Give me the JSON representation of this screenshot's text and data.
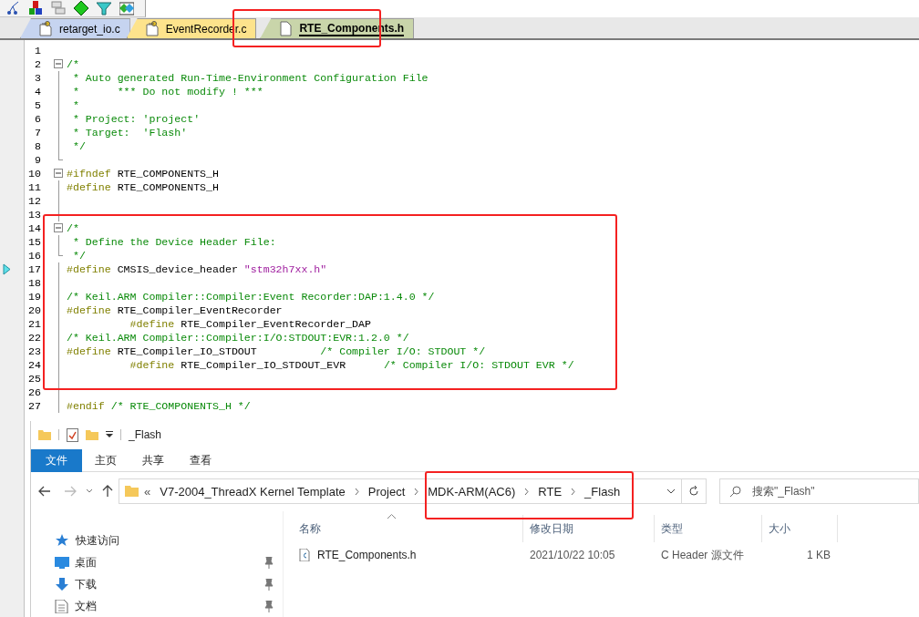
{
  "editor_tabs": [
    {
      "label": "retarget_io.c",
      "kind": "source",
      "color": "#c6d4f0",
      "selected": false
    },
    {
      "label": "EventRecorder.c",
      "kind": "source",
      "color": "#fde38c",
      "selected": false
    },
    {
      "label": "RTE_Components.h",
      "kind": "header",
      "color": "#c9d5aa",
      "selected": true
    }
  ],
  "code_lines": [
    {
      "number": "1"
    },
    {
      "number": "2",
      "fold_start": true,
      "tokens": [
        {
          "kind": "comment",
          "text": "/*"
        }
      ]
    },
    {
      "number": "3",
      "tokens": [
        {
          "kind": "comment",
          "text": " * Auto generated Run-Time-Environment Configuration File"
        }
      ]
    },
    {
      "number": "4",
      "tokens": [
        {
          "kind": "comment",
          "text": " *      *** Do not modify ! ***"
        }
      ]
    },
    {
      "number": "5",
      "tokens": [
        {
          "kind": "comment",
          "text": " *"
        }
      ]
    },
    {
      "number": "6",
      "tokens": [
        {
          "kind": "comment",
          "text": " * Project: 'project'"
        }
      ]
    },
    {
      "number": "7",
      "tokens": [
        {
          "kind": "comment",
          "text": " * Target:  'Flash'"
        }
      ]
    },
    {
      "number": "8",
      "tokens": [
        {
          "kind": "comment",
          "text": " */"
        }
      ]
    },
    {
      "number": "9",
      "fold_end": true
    },
    {
      "number": "10",
      "fold_start": true,
      "tokens": [
        {
          "kind": "directive",
          "text": "#ifndef"
        },
        {
          "kind": "plain",
          "text": " RTE_COMPONENTS_H"
        }
      ]
    },
    {
      "number": "11",
      "tokens": [
        {
          "kind": "directive",
          "text": "#define"
        },
        {
          "kind": "plain",
          "text": " RTE_COMPONENTS_H"
        }
      ]
    },
    {
      "number": "12"
    },
    {
      "number": "13"
    },
    {
      "number": "14",
      "fold_start": true,
      "tokens": [
        {
          "kind": "comment",
          "text": "/*"
        }
      ]
    },
    {
      "number": "15",
      "tokens": [
        {
          "kind": "comment",
          "text": " * Define the Device Header File:"
        }
      ]
    },
    {
      "number": "16",
      "fold_end": true,
      "tokens": [
        {
          "kind": "comment",
          "text": " */"
        }
      ]
    },
    {
      "number": "17",
      "current": true,
      "tokens": [
        {
          "kind": "directive",
          "text": "#define"
        },
        {
          "kind": "plain",
          "text": " CMSIS_device_header "
        },
        {
          "kind": "string",
          "text": "\"stm32h7xx.h\""
        }
      ]
    },
    {
      "number": "18"
    },
    {
      "number": "19",
      "tokens": [
        {
          "kind": "comment",
          "text": "/* Keil.ARM Compiler::Compiler:Event Recorder:DAP:1.4.0 */"
        }
      ]
    },
    {
      "number": "20",
      "tokens": [
        {
          "kind": "directive",
          "text": "#define"
        },
        {
          "kind": "plain",
          "text": " RTE_Compiler_EventRecorder"
        }
      ]
    },
    {
      "number": "21",
      "tokens": [
        {
          "kind": "directive",
          "text": "          #define"
        },
        {
          "kind": "plain",
          "text": " RTE_Compiler_EventRecorder_DAP"
        }
      ]
    },
    {
      "number": "22",
      "tokens": [
        {
          "kind": "comment",
          "text": "/* Keil.ARM Compiler::Compiler:I/O:STDOUT:EVR:1.2.0 */"
        }
      ]
    },
    {
      "number": "23",
      "tokens": [
        {
          "kind": "directive",
          "text": "#define"
        },
        {
          "kind": "plain",
          "text": " RTE_Compiler_IO_STDOUT          "
        },
        {
          "kind": "comment",
          "text": "/* Compiler I/O: STDOUT */"
        }
      ]
    },
    {
      "number": "24",
      "tokens": [
        {
          "kind": "directive",
          "text": "          #define"
        },
        {
          "kind": "plain",
          "text": " RTE_Compiler_IO_STDOUT_EVR      "
        },
        {
          "kind": "comment",
          "text": "/* Compiler I/O: STDOUT EVR */"
        }
      ]
    },
    {
      "number": "25"
    },
    {
      "number": "26"
    },
    {
      "number": "27",
      "tokens": [
        {
          "kind": "directive",
          "text": "#endif"
        },
        {
          "kind": "comment",
          "text": " /* RTE_COMPONENTS_H */"
        }
      ]
    }
  ],
  "explorer": {
    "title": "_Flash",
    "ribbon_tabs": [
      {
        "label": "文件",
        "selected": true
      },
      {
        "label": "主页",
        "selected": false
      },
      {
        "label": "共享",
        "selected": false
      },
      {
        "label": "查看",
        "selected": false
      }
    ],
    "path_overflow": "«",
    "breadcrumbs": [
      "V7-2004_ThreadX Kernel Template",
      "Project",
      "MDK-ARM(AC6)",
      "RTE",
      "_Flash"
    ],
    "search": {
      "placeholder": "搜索\"_Flash\""
    },
    "nav_items": [
      {
        "label": "快速访问",
        "kind": "quick-access",
        "pinned": false
      },
      {
        "label": "桌面",
        "kind": "desktop",
        "pinned": true
      },
      {
        "label": "下载",
        "kind": "downloads",
        "pinned": true
      },
      {
        "label": "文档",
        "kind": "documents",
        "pinned": true
      }
    ],
    "columns": [
      "名称",
      "修改日期",
      "类型",
      "大小"
    ],
    "rows": [
      {
        "name": "RTE_Components.h",
        "modified": "2021/10/22 10:05",
        "type": "C Header 源文件",
        "size": "1 KB"
      }
    ]
  },
  "annotation_boxes": [
    {
      "kind": "tab"
    },
    {
      "kind": "code"
    },
    {
      "kind": "path"
    }
  ]
}
